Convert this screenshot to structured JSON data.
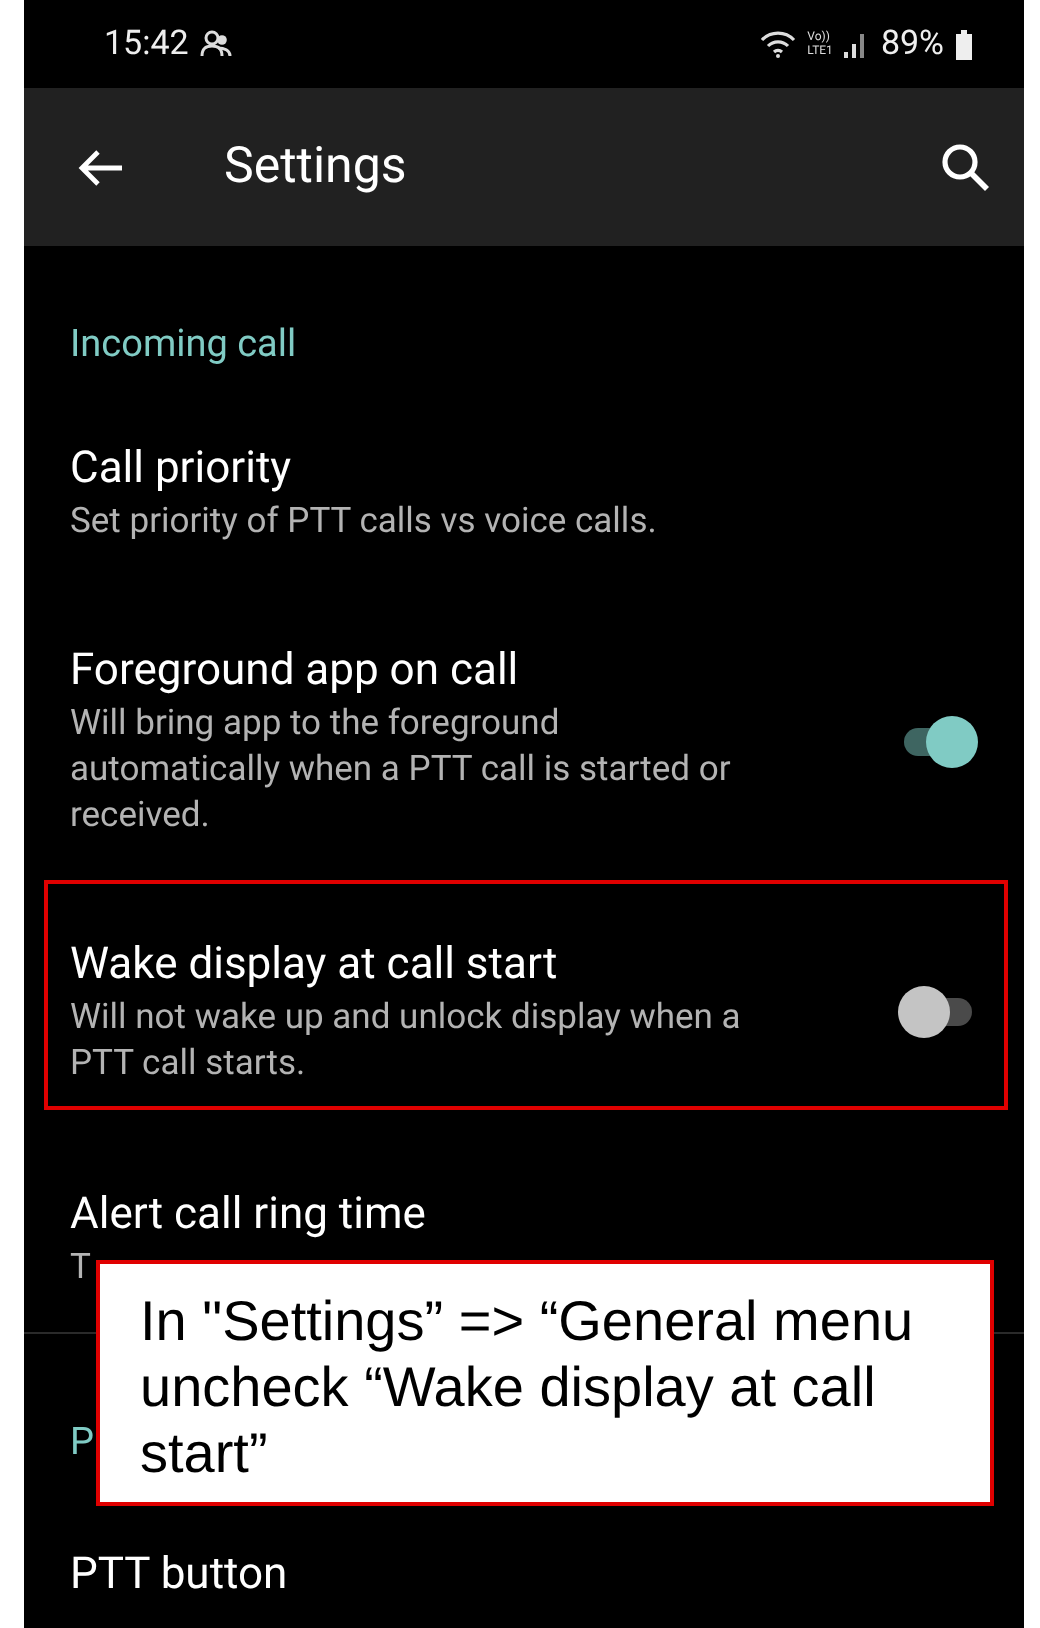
{
  "status_bar": {
    "time": "15:42",
    "volte_top": "Vo))",
    "volte_bottom": "LTE1",
    "battery": "89%"
  },
  "toolbar": {
    "title": "Settings"
  },
  "list": [
    {
      "kind": "header",
      "title": "Incoming call"
    },
    {
      "kind": "setting",
      "title": "Call priority",
      "subtitle": "Set priority of PTT calls vs voice calls.",
      "highlighted": false
    },
    {
      "kind": "switch",
      "title": "Foreground app on call",
      "subtitle": "Will bring app to the foreground automatically when a PTT call is started or received.",
      "on": true,
      "highlighted": false
    },
    {
      "kind": "switch",
      "title": "Wake display at call start",
      "subtitle": "Will not wake up and unlock display when a PTT call starts.",
      "on": false,
      "highlighted": true
    },
    {
      "kind": "setting",
      "title": "Alert call ring time",
      "subtitle": "T",
      "highlighted": false
    },
    {
      "kind": "divider"
    },
    {
      "kind": "header",
      "title": "P"
    },
    {
      "kind": "setting",
      "title": "PTT button",
      "highlighted": false
    }
  ],
  "callout": {
    "text": "In \"Settings” => “General menu uncheck “Wake display at call start”"
  }
}
